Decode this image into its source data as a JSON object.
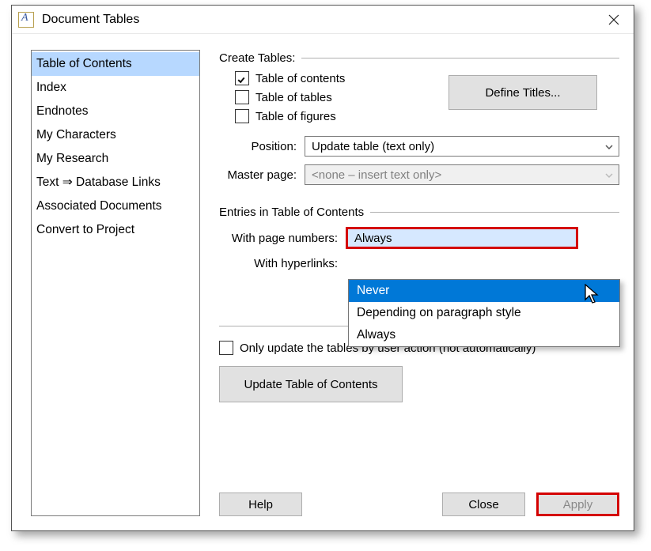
{
  "window": {
    "title": "Document Tables"
  },
  "sidebar": {
    "items": [
      "Table of Contents",
      "Index",
      "Endnotes",
      "My Characters",
      "My Research",
      "Text ⇒ Database Links",
      "Associated Documents",
      "Convert to Project"
    ],
    "selected_index": 0
  },
  "create_tables": {
    "group_label": "Create Tables:",
    "toc": {
      "label": "Table of contents",
      "checked": true
    },
    "tot": {
      "label": "Table of tables",
      "checked": false
    },
    "tof": {
      "label": "Table of figures",
      "checked": false
    },
    "define_titles_label": "Define Titles...",
    "position_label": "Position:",
    "position_value": "Update table (text only)",
    "master_label": "Master page:",
    "master_value": "<none – insert text only>"
  },
  "entries": {
    "group_label": "Entries in Table of Contents",
    "page_numbers_label": "With page numbers:",
    "page_numbers_value": "Always",
    "hyperlinks_label": "With hyperlinks:",
    "dropdown_options": [
      "Never",
      "Depending on paragraph style",
      "Always"
    ],
    "dropdown_hover_index": 0
  },
  "update": {
    "only_update_label": "Only update the tables by user action (not automatically)",
    "only_update_checked": false,
    "update_button": "Update Table of Contents"
  },
  "buttons": {
    "help": "Help",
    "close": "Close",
    "apply": "Apply"
  }
}
